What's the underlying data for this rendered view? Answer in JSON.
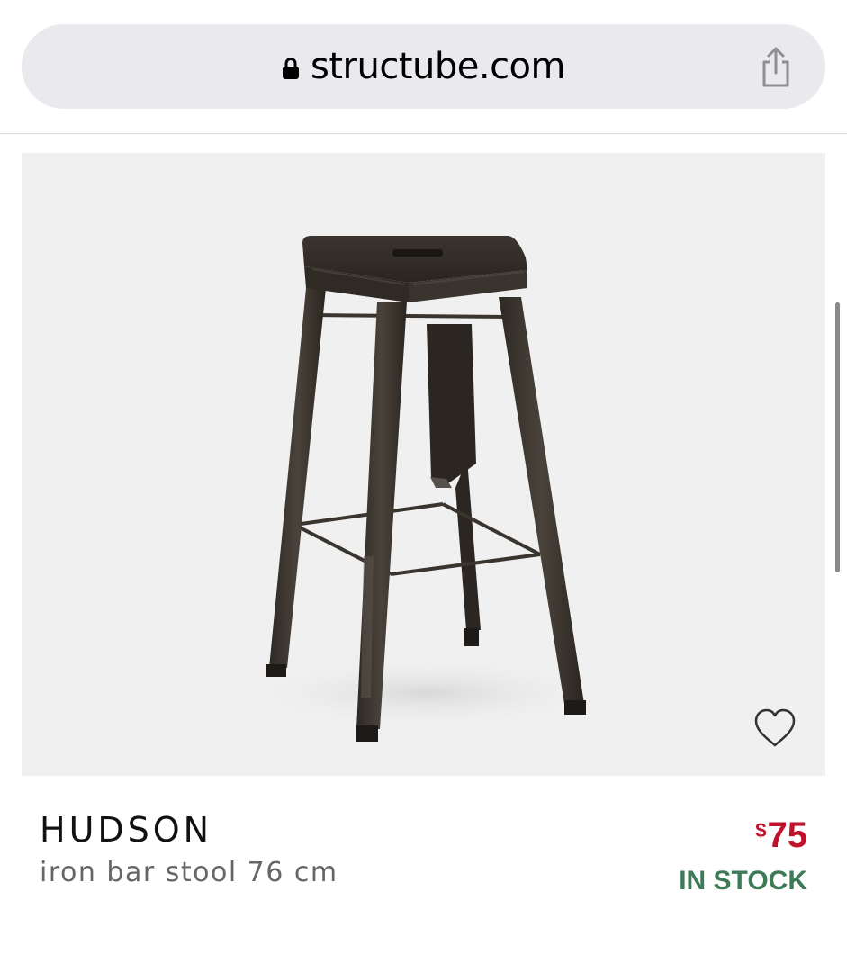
{
  "browser": {
    "url": "structube.com",
    "lock_icon": "lock-icon",
    "share_icon": "share-icon"
  },
  "product": {
    "image_subject": "Hudson iron bar stool",
    "favorite_icon": "heart-outline-icon",
    "name": "HUDSON",
    "description": "iron bar stool 76 cm",
    "price_currency": "$",
    "price_amount": "75",
    "stock_status": "IN STOCK"
  },
  "colors": {
    "price": "#c0102b",
    "stock": "#3d7a55",
    "image_background": "#f0f0f0",
    "url_bar": "#e9e9ee"
  }
}
